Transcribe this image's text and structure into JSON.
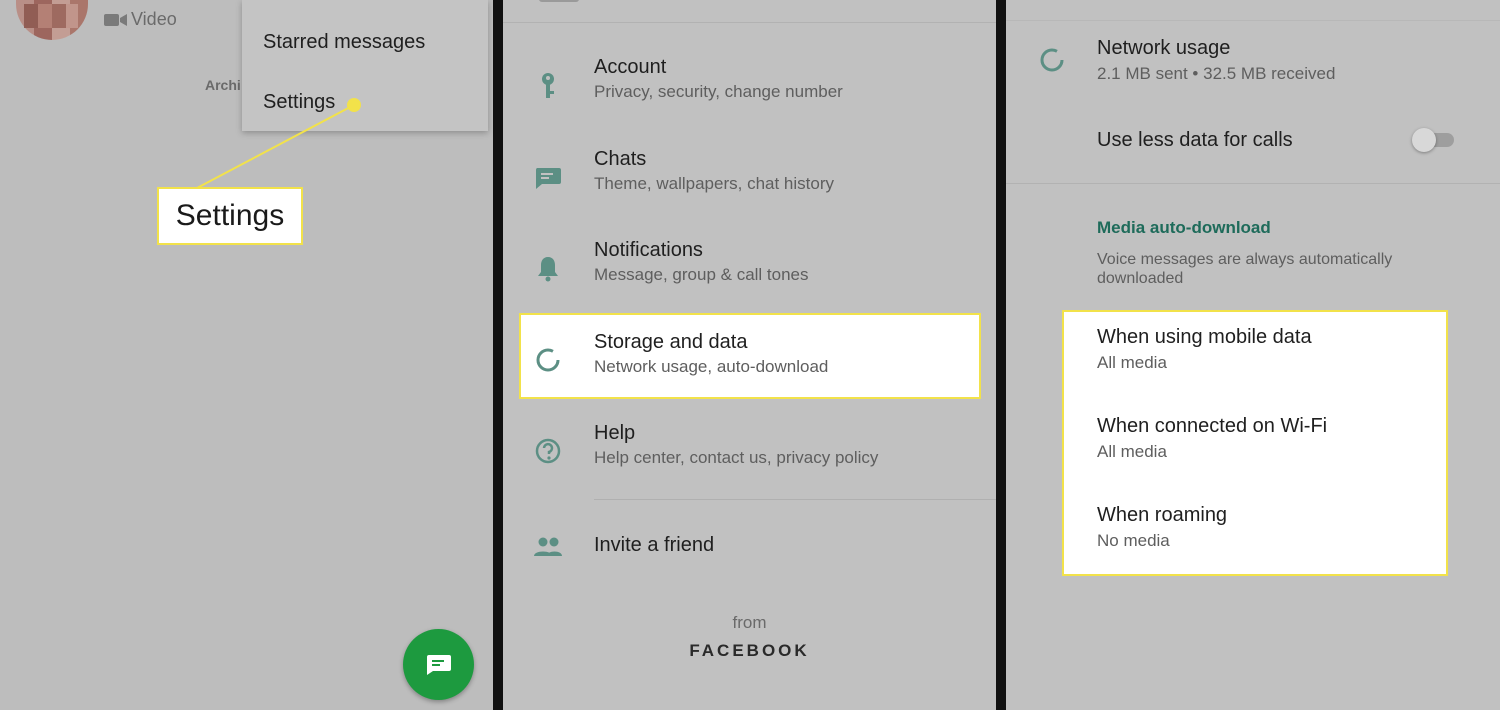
{
  "left_panel": {
    "video_label": "Video",
    "archived_label": "Archi",
    "menu": {
      "items": [
        "Starred messages",
        "Settings"
      ]
    },
    "callout": "Settings"
  },
  "settings_panel": {
    "rows": [
      {
        "title": "Account",
        "subtitle": "Privacy, security, change number",
        "icon": "key-icon"
      },
      {
        "title": "Chats",
        "subtitle": "Theme, wallpapers, chat history",
        "icon": "chat-icon"
      },
      {
        "title": "Notifications",
        "subtitle": "Message, group & call tones",
        "icon": "bell-icon"
      },
      {
        "title": "Storage and data",
        "subtitle": "Network usage, auto-download",
        "icon": "data-usage-icon"
      },
      {
        "title": "Help",
        "subtitle": "Help center, contact us, privacy policy",
        "icon": "help-icon"
      }
    ],
    "invite": {
      "title": "Invite a friend",
      "icon": "people-icon"
    },
    "footer": {
      "from": "from",
      "brand": "FACEBOOK"
    }
  },
  "storage_panel": {
    "network_usage": {
      "title": "Network usage",
      "subtitle": "2.1 MB sent • 32.5 MB received"
    },
    "less_data": {
      "title": "Use less data for calls",
      "enabled": false
    },
    "media_section": {
      "heading": "Media auto-download",
      "note": "Voice messages are always automatically downloaded",
      "items": [
        {
          "title": "When using mobile data",
          "subtitle": "All media"
        },
        {
          "title": "When connected on Wi-Fi",
          "subtitle": "All media"
        },
        {
          "title": "When roaming",
          "subtitle": "No media"
        }
      ]
    }
  },
  "colors": {
    "accent_green": "#1d9a3f",
    "icon_teal": "#5c8f84",
    "section_teal": "#1e6b5a",
    "highlight_yellow": "#f2e24a"
  }
}
